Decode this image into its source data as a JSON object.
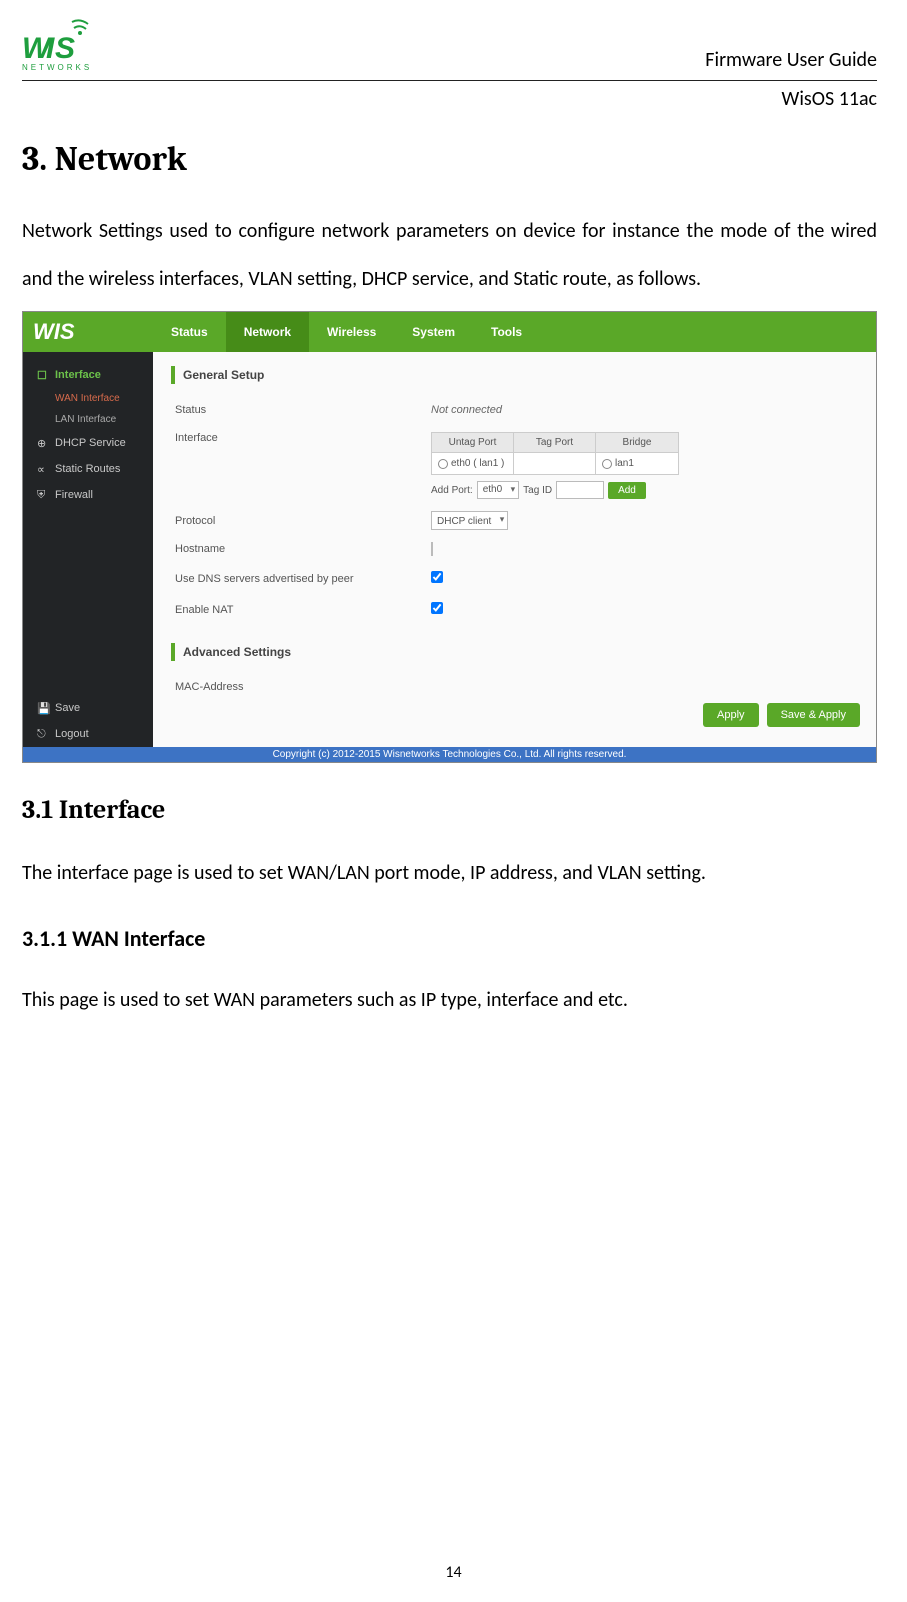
{
  "header": {
    "logo_top": "WIS",
    "logo_bottom": "NETWORKS",
    "title": "Firmware User Guide",
    "os": "WisOS 11ac"
  },
  "section": {
    "h1": "3. Network",
    "intro": "Network Settings used to configure network parameters on device for instance the mode of the wired and the wireless interfaces, VLAN setting, DHCP service, and Static route, as follows.",
    "h2": "3.1 Interface",
    "p2": "The interface page is used to set WAN/LAN port mode, IP address, and VLAN setting.",
    "h3": "3.1.1 WAN Interface",
    "p3": "This page is used to set WAN parameters such as IP type, interface and etc."
  },
  "page_number": "14",
  "screenshot": {
    "logo": "WIS",
    "nav": [
      "Status",
      "Network",
      "Wireless",
      "System",
      "Tools"
    ],
    "nav_active_index": 1,
    "sidebar": {
      "items": [
        {
          "label": "Interface",
          "icon": "layers-icon",
          "active": true,
          "subs": [
            {
              "label": "WAN Interface",
              "selected": true
            },
            {
              "label": "LAN Interface",
              "selected": false
            }
          ]
        },
        {
          "label": "DHCP Service",
          "icon": "globe-icon"
        },
        {
          "label": "Static Routes",
          "icon": "share-icon"
        },
        {
          "label": "Firewall",
          "icon": "shield-icon"
        }
      ],
      "footer": [
        {
          "label": "Save",
          "icon": "save-icon"
        },
        {
          "label": "Logout",
          "icon": "logout-icon"
        }
      ]
    },
    "main": {
      "general_title": "General Setup",
      "advanced_title": "Advanced Settings",
      "status_label": "Status",
      "status_value": "Not connected",
      "interface_label": "Interface",
      "port_headers": [
        "Untag Port",
        "Tag Port",
        "Bridge"
      ],
      "port_row": {
        "untag": "eth0 ( lan1 )",
        "tag": "",
        "bridge": "lan1"
      },
      "addport_label": "Add Port:",
      "addport_select": "eth0",
      "tagid_label": "Tag ID",
      "add_btn": "Add",
      "protocol_label": "Protocol",
      "protocol_value": "DHCP client",
      "hostname_label": "Hostname",
      "dns_label": "Use DNS servers advertised by peer",
      "nat_label": "Enable NAT",
      "mac_label": "MAC-Address",
      "apply_btn": "Apply",
      "saveapply_btn": "Save & Apply"
    },
    "copyright": "Copyright (c) 2012-2015 Wisnetworks Technologies Co., Ltd. All rights reserved."
  }
}
